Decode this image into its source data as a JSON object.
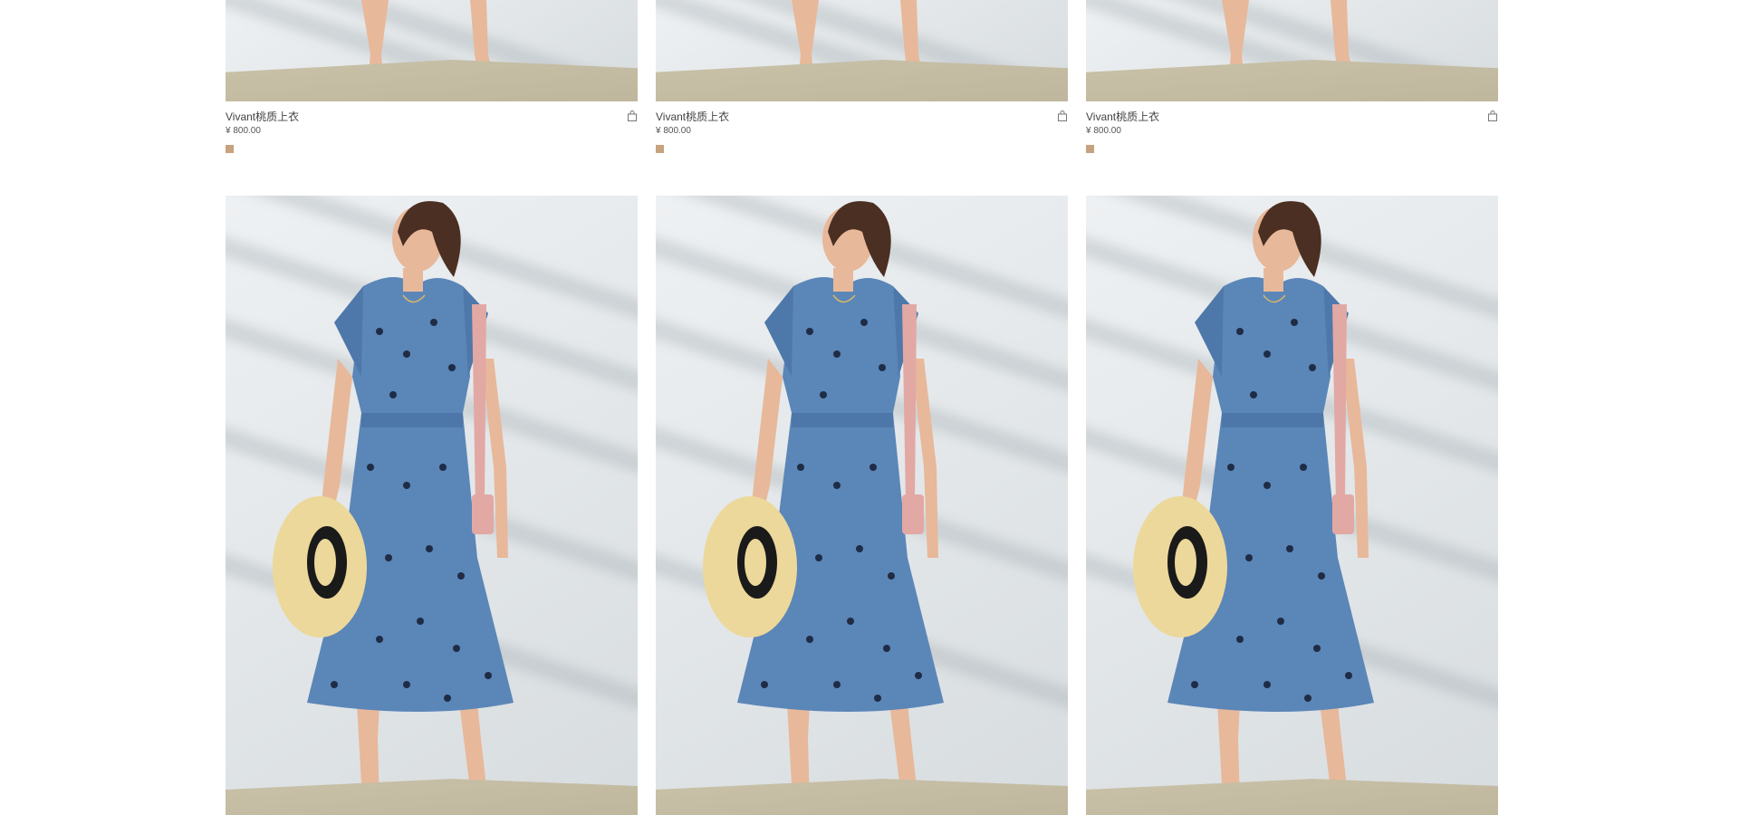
{
  "products_top": [
    {
      "name": "Vivant桃质上衣",
      "price": "¥ 800.00",
      "swatch_color": "#c7a27e"
    },
    {
      "name": "Vivant桃质上衣",
      "price": "¥ 800.00",
      "swatch_color": "#c7a27e"
    },
    {
      "name": "Vivant桃质上衣",
      "price": "¥ 800.00",
      "swatch_color": "#c7a27e"
    }
  ],
  "icons": {
    "cart": "shopping-bag-icon"
  },
  "colors": {
    "dress": "#5b86b8",
    "dots": "#1f2c45",
    "hat": "#ecd89a",
    "hat_band": "#1a1a1a",
    "bag": "#e2a8a4",
    "skin": "#e8b89a",
    "hair": "#4a2f22"
  }
}
